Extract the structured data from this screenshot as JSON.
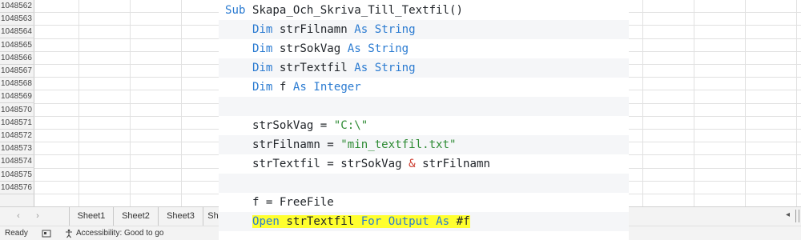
{
  "spreadsheet": {
    "row_numbers": [
      "1048562",
      "1048563",
      "1048564",
      "1048565",
      "1048566",
      "1048567",
      "1048568",
      "1048569",
      "1048570",
      "1048571",
      "1048572",
      "1048573",
      "1048574",
      "1048575",
      "1048576"
    ],
    "tabs": {
      "nav_prev": "‹",
      "nav_next": "›",
      "sheets": [
        "Sheet1",
        "Sheet2",
        "Sheet3",
        "Sh"
      ]
    },
    "scroll_arrow": "◂"
  },
  "status_bar": {
    "ready": "Ready",
    "accessibility": "Accessibility: Good to go"
  },
  "code": {
    "lines": [
      {
        "indent": "",
        "tokens": [
          {
            "t": "Sub",
            "c": "kw"
          },
          {
            "t": " Skapa_Och_Skriva_Till_Textfil()",
            "c": ""
          }
        ]
      },
      {
        "indent": "    ",
        "tokens": [
          {
            "t": "Dim",
            "c": "kw"
          },
          {
            "t": " strFilnamn ",
            "c": ""
          },
          {
            "t": "As",
            "c": "kw"
          },
          {
            "t": " ",
            "c": ""
          },
          {
            "t": "String",
            "c": "kw"
          }
        ]
      },
      {
        "indent": "    ",
        "tokens": [
          {
            "t": "Dim",
            "c": "kw"
          },
          {
            "t": " strSokVag ",
            "c": ""
          },
          {
            "t": "As",
            "c": "kw"
          },
          {
            "t": " ",
            "c": ""
          },
          {
            "t": "String",
            "c": "kw"
          }
        ]
      },
      {
        "indent": "    ",
        "tokens": [
          {
            "t": "Dim",
            "c": "kw"
          },
          {
            "t": " strTextfil ",
            "c": ""
          },
          {
            "t": "As",
            "c": "kw"
          },
          {
            "t": " ",
            "c": ""
          },
          {
            "t": "String",
            "c": "kw"
          }
        ]
      },
      {
        "indent": "    ",
        "tokens": [
          {
            "t": "Dim",
            "c": "kw"
          },
          {
            "t": " f ",
            "c": ""
          },
          {
            "t": "As",
            "c": "kw"
          },
          {
            "t": " ",
            "c": ""
          },
          {
            "t": "Integer",
            "c": "kw"
          }
        ]
      },
      {
        "indent": "",
        "tokens": []
      },
      {
        "indent": "    ",
        "tokens": [
          {
            "t": "strSokVag = ",
            "c": ""
          },
          {
            "t": "\"C:\\\"",
            "c": "str"
          }
        ]
      },
      {
        "indent": "    ",
        "tokens": [
          {
            "t": "strFilnamn = ",
            "c": ""
          },
          {
            "t": "\"min_textfil.txt\"",
            "c": "str"
          }
        ]
      },
      {
        "indent": "    ",
        "tokens": [
          {
            "t": "strTextfil = strSokVag ",
            "c": ""
          },
          {
            "t": "&",
            "c": "amp"
          },
          {
            "t": " strFilnamn",
            "c": ""
          }
        ]
      },
      {
        "indent": "",
        "tokens": []
      },
      {
        "indent": "    ",
        "tokens": [
          {
            "t": "f = FreeFile",
            "c": ""
          }
        ]
      },
      {
        "indent": "    ",
        "highlight": true,
        "tokens": [
          {
            "t": "Open",
            "c": "kw"
          },
          {
            "t": " strTextfil ",
            "c": ""
          },
          {
            "t": "For",
            "c": "kw"
          },
          {
            "t": " ",
            "c": ""
          },
          {
            "t": "Output",
            "c": "kw"
          },
          {
            "t": " ",
            "c": ""
          },
          {
            "t": "As",
            "c": "kw"
          },
          {
            "t": " #f",
            "c": ""
          }
        ]
      }
    ]
  },
  "colors": {
    "keyword": "#2b7bd1",
    "string": "#2e8b34",
    "operator": "#cc3c2f",
    "highlight": "#ffff2e"
  }
}
